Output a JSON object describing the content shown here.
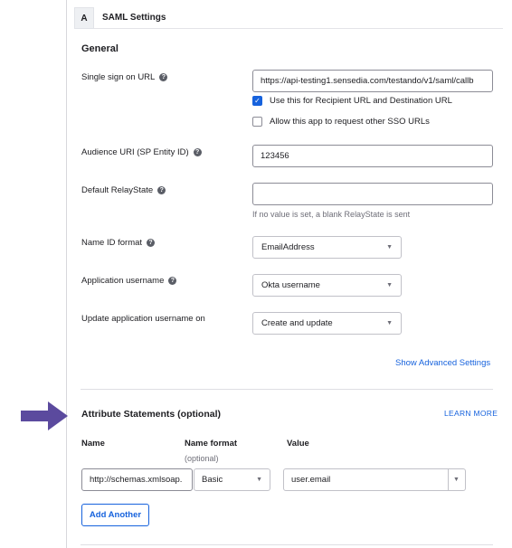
{
  "section": {
    "letter": "A",
    "title": "SAML Settings"
  },
  "general": {
    "heading": "General",
    "sso_url": {
      "label": "Single sign on URL",
      "value": "https://api-testing1.sensedia.com/testando/v1/saml/callb"
    },
    "checks": [
      {
        "label": "Use this for Recipient URL and Destination URL",
        "checked": true
      },
      {
        "label": "Allow this app to request other SSO URLs",
        "checked": false
      }
    ],
    "audience": {
      "label": "Audience URI (SP Entity ID)",
      "value": "123456"
    },
    "relay": {
      "label": "Default RelayState",
      "value": "",
      "hint": "If no value is set, a blank RelayState is sent"
    },
    "name_id": {
      "label": "Name ID format",
      "value": "EmailAddress"
    },
    "app_username": {
      "label": "Application username",
      "value": "Okta username"
    },
    "update_on": {
      "label": "Update application username on",
      "value": "Create and update"
    },
    "advanced_link": "Show Advanced Settings"
  },
  "attributes": {
    "heading": "Attribute Statements (optional)",
    "learn_more": "LEARN MORE",
    "columns": {
      "name": "Name",
      "format": "Name format",
      "format_sub": "(optional)",
      "value": "Value"
    },
    "row": {
      "name": "http://schemas.xmlsoap.",
      "format": "Basic",
      "value": "user.email"
    },
    "add_button": "Add Another"
  },
  "icons": {
    "help": "help-circle-icon",
    "caret": "chevron-down-icon",
    "check": "checkmark-icon",
    "arrow": "right-arrow-icon"
  },
  "colors": {
    "accent": "#1662dd",
    "arrow": "#5b4a9e"
  }
}
